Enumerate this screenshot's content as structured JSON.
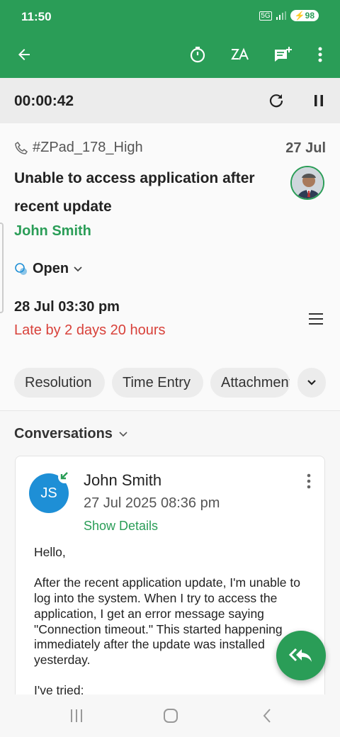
{
  "status_bar": {
    "time": "11:50",
    "network": "5G",
    "battery": "98"
  },
  "app_bar": {
    "back_icon": "arrow-left-icon",
    "actions": [
      "timer-icon",
      "translate-icon",
      "add-comment-icon",
      "more-vert-icon"
    ]
  },
  "timer": {
    "elapsed": "00:00:42",
    "refresh_icon": "refresh-icon",
    "pause_icon": "pause-icon"
  },
  "ticket": {
    "id": "#ZPad_178_High",
    "date": "27 Jul",
    "subject": "Unable to access application after recent update",
    "contact": "John Smith",
    "status": "Open",
    "due": "28 Jul 03:30 pm",
    "late": "Late by 2 days 20 hours"
  },
  "tabs": [
    "Resolution",
    "Time Entry",
    "Attachments"
  ],
  "conversations": {
    "header": "Conversations",
    "items": [
      {
        "initials": "JS",
        "name": "John Smith",
        "sent": "27 Jul 2025 08:36 pm",
        "show_details": "Show Details",
        "greeting": "Hello,",
        "paragraph": "After the recent application update, I'm unable to log into the system. When I try to access the application, I get an error message saying \"Connection timeout.\" This started happening immediately after the update was installed yesterday.",
        "tried": "I've tried:"
      }
    ]
  },
  "colors": {
    "brand": "#2a9d57",
    "late": "#d8413a",
    "avatar": "#1e8fd6"
  }
}
